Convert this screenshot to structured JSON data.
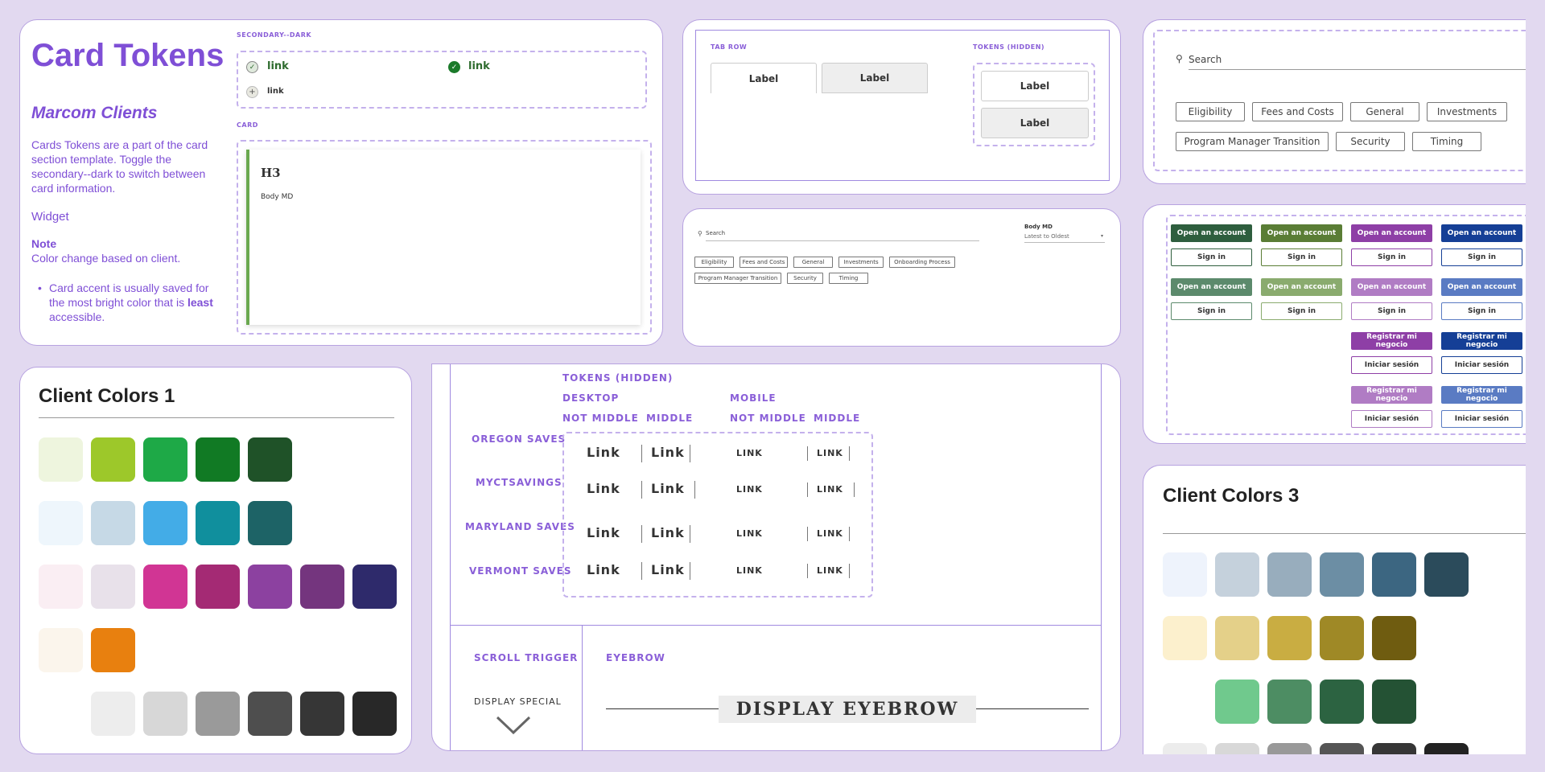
{
  "card_tokens": {
    "title": "Card Tokens",
    "subtitle": "Marcom Clients",
    "description": "Cards Tokens are a part of the card section template. Toggle the secondary--dark to switch between card information.",
    "widget": "Widget",
    "note_label": "Note",
    "note_text": "Color change based on client.",
    "bullet_pre": "Card accent is usually saved for the most bright color that is ",
    "bullet_bold": "least",
    "bullet_post": " accessible.",
    "secondary_label": "SECONDARY--DARK",
    "link1": "link",
    "link2": "link",
    "link3": "link",
    "card_label": "CARD",
    "card_heading": "H3",
    "card_body": "Body MD",
    "accent_color": "#6aa84f"
  },
  "tab_panel": {
    "tab_row_label": "TAB ROW",
    "tokens_label": "TOKENS (HIDDEN)",
    "tab1": "Label",
    "tab2": "Label",
    "tok1": "Label",
    "tok2": "Label"
  },
  "search_small": {
    "placeholder": "Search",
    "sort_label": "Body MD",
    "sort_value": "Latest to Oldest",
    "chips": [
      "Eligibility",
      "Fees and Costs",
      "General",
      "Investments",
      "Onboarding Process",
      "Program Manager Transition",
      "Security",
      "Timing"
    ]
  },
  "search_large": {
    "placeholder": "Search",
    "chips": [
      "Eligibility",
      "Fees and Costs",
      "General",
      "Investments",
      "Program Manager Transition",
      "Security",
      "Timing"
    ]
  },
  "buttons": {
    "open_account": "Open an account",
    "sign_in": "Sign in",
    "registrar": "Registrar mi negocio",
    "iniciar": "Iniciar sesión",
    "colors_row1": [
      "#2e5e3e",
      "#5a7d35",
      "#8e3fa6",
      "#153f96"
    ],
    "colors_row2": [
      "#5c8a6c",
      "#8aab6e",
      "#b07cc4",
      "#5a7bc3"
    ]
  },
  "client_colors_1": {
    "title": "Client Colors 1",
    "rows": [
      [
        "#eef5de",
        "#9dc82a",
        "#1ea947",
        "#117a24",
        "#1f5228"
      ],
      [
        "#eef6fc",
        "#c6d9e6",
        "#43ace7",
        "#108f9d",
        "#1d6366"
      ],
      [
        "#faeef3",
        "#e8e1ea",
        "#d13594",
        "#a42a74",
        "#8c41a0",
        "#74357e",
        "#2e2a6b"
      ],
      [
        "#fbf5ec",
        "#e8800f"
      ],
      [
        "#ededed",
        "#d7d7d7",
        "#9a9a9a",
        "#4e4e4e",
        "#363636",
        "#282828"
      ]
    ]
  },
  "client_colors_3": {
    "title": "Client Colors 3",
    "rows": [
      [
        "#eef3fc",
        "#c5d1dc",
        "#98adbd",
        "#6c8ea4",
        "#3c6681",
        "#2b4b5b"
      ],
      [
        "#fcf0cd",
        "#e4d089",
        "#c9ad42",
        "#9f8926",
        "#6f5c10"
      ],
      [
        "#70c98d",
        "#4d8d63",
        "#2c6341",
        "#245234"
      ],
      [
        "#ececec",
        "#d8d8d8",
        "#999999",
        "#555555",
        "#363636",
        "#222222"
      ]
    ]
  },
  "links_panel": {
    "tokens": "TOKENS (HIDDEN)",
    "desktop": "DESKTOP",
    "mobile": "MOBILE",
    "not_middle": "NOT MIDDLE",
    "middle": "MIDDLE",
    "clients": [
      "OREGON SAVES",
      "MYCTSAVINGS",
      "MARYLAND SAVES",
      "VERMONT SAVES"
    ],
    "link_lg": "Link",
    "link_sm": "LINK",
    "scroll_trigger": "SCROLL TRIGGER",
    "display_special": "DISPLAY SPECIAL",
    "eyebrow": "EYEBROW",
    "display_eyebrow": "DISPLAY EYEBROW"
  }
}
